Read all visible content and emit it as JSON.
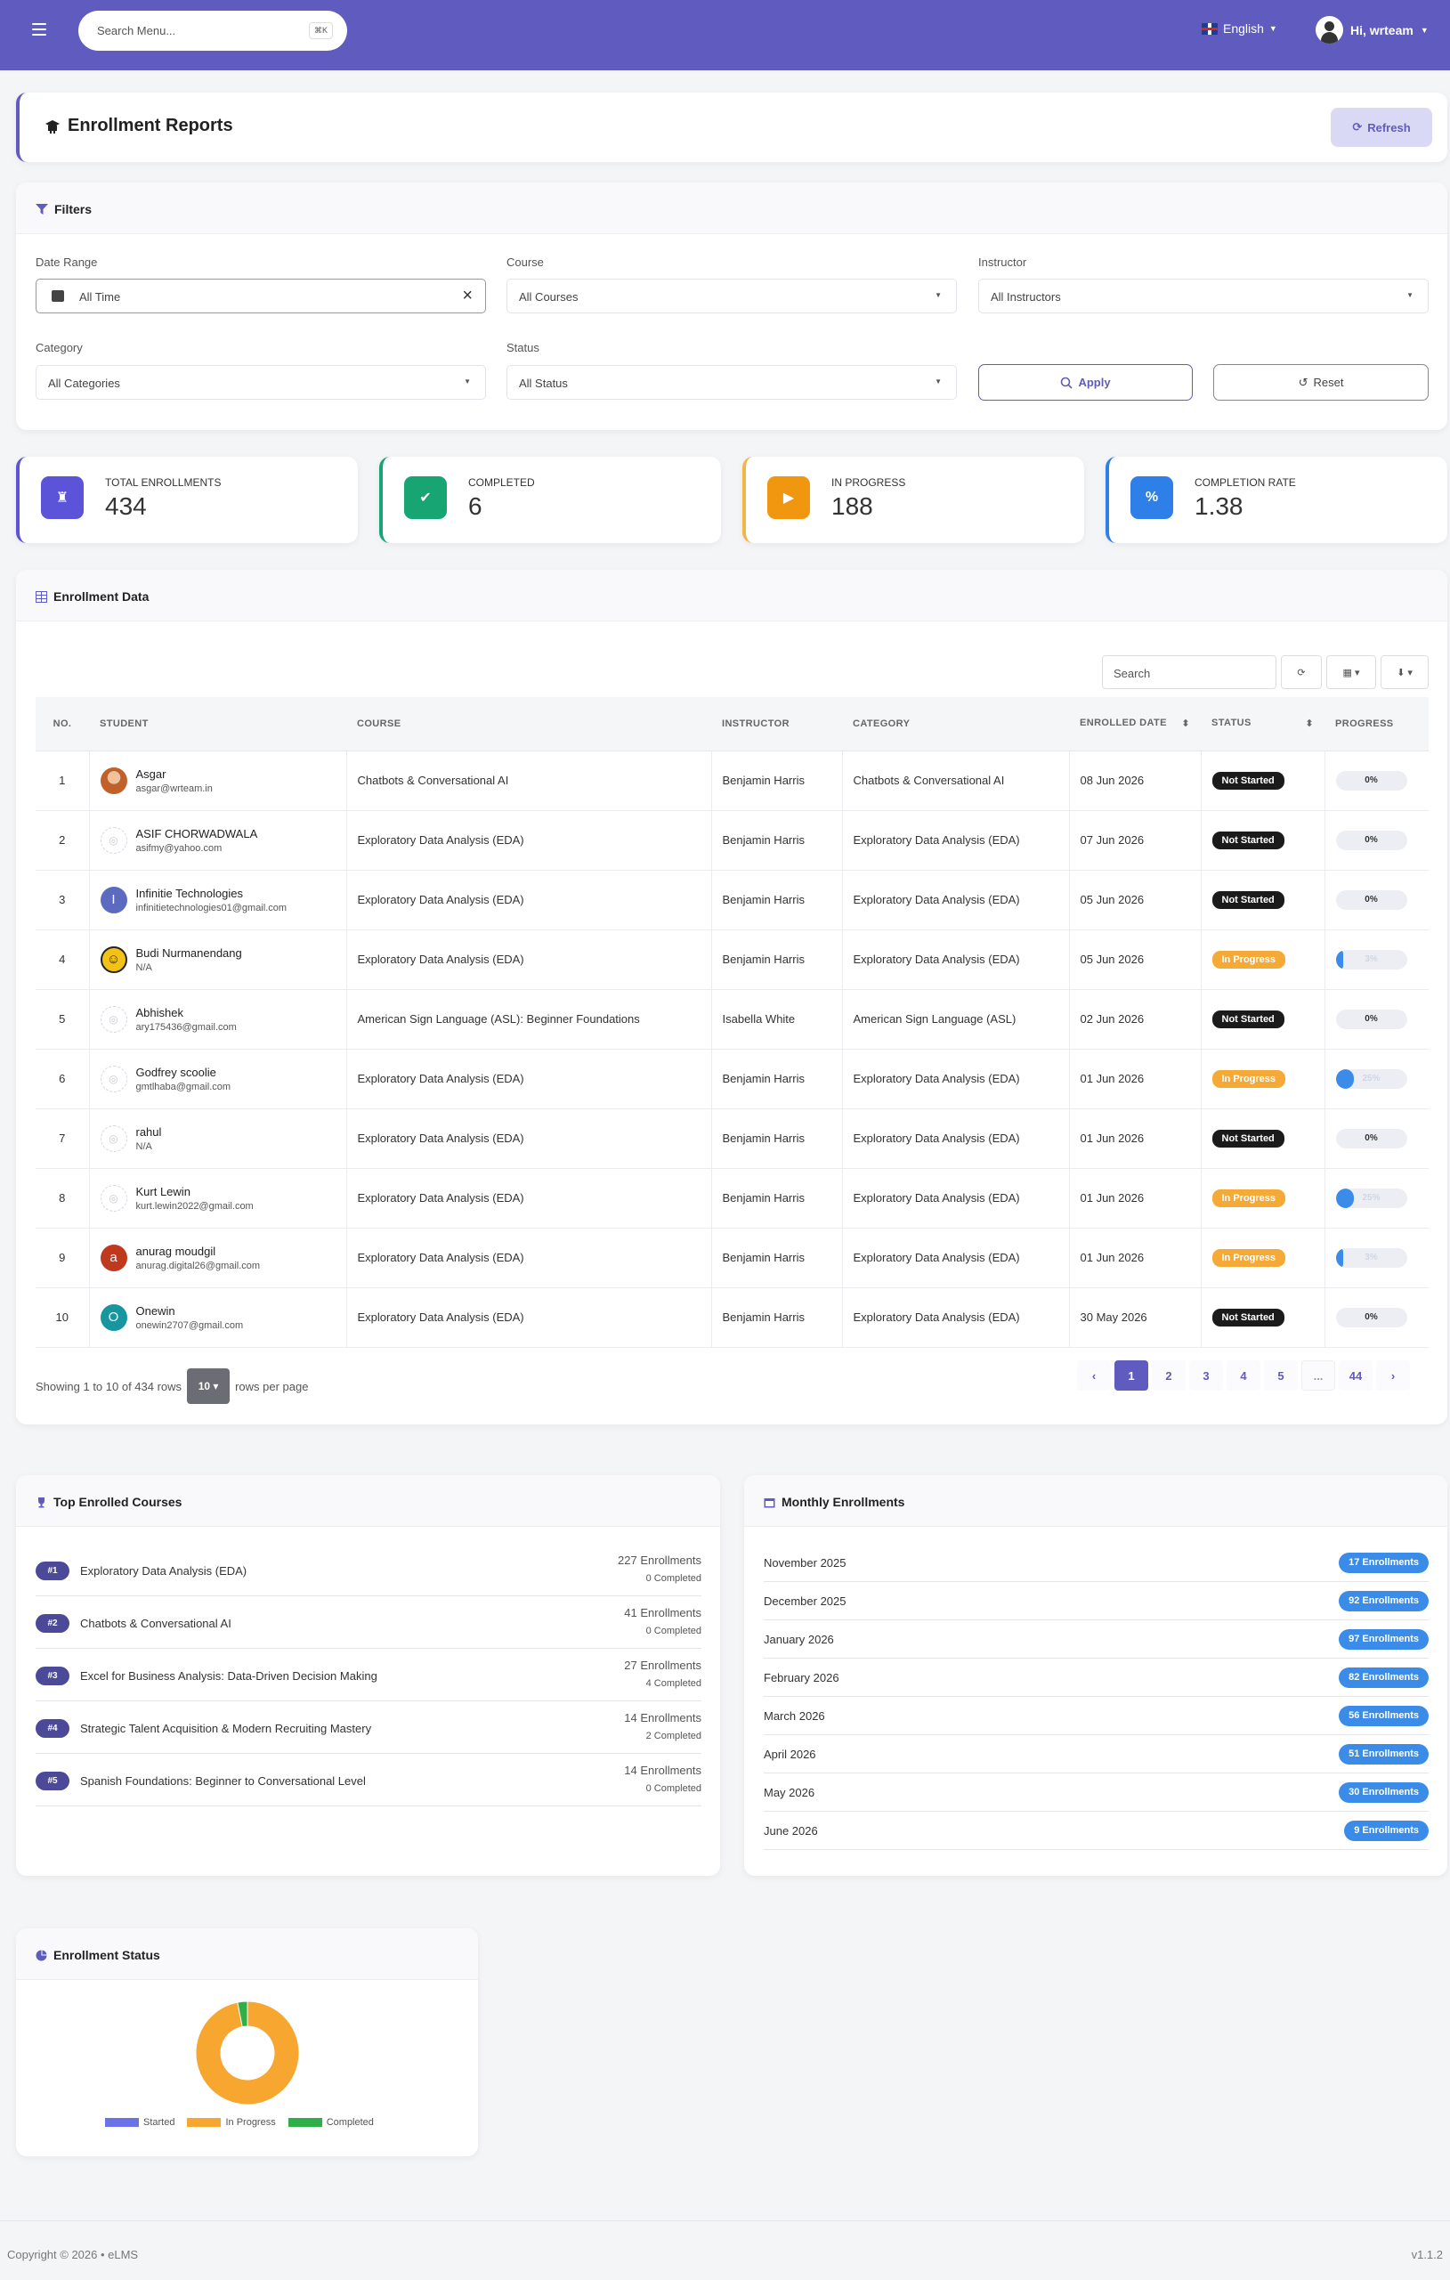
{
  "topbar": {
    "search_placeholder": "Search Menu...",
    "search_shortcut": "⌘K",
    "language": "English",
    "greeting": "Hi, wrteam"
  },
  "page": {
    "title": "Enrollment Reports",
    "refresh_label": "Refresh"
  },
  "filters": {
    "title": "Filters",
    "date_range_label": "Date Range",
    "date_range_value": "All Time",
    "course_label": "Course",
    "course_value": "All Courses",
    "instructor_label": "Instructor",
    "instructor_value": "All Instructors",
    "category_label": "Category",
    "category_value": "All Categories",
    "status_label": "Status",
    "status_value": "All Status",
    "apply_label": "Apply",
    "reset_label": "Reset"
  },
  "stats": [
    {
      "label": "TOTAL ENROLLMENTS",
      "value": "434",
      "color": "#5b54d9",
      "border": "#5b54d9",
      "glyph": "♜"
    },
    {
      "label": "COMPLETED",
      "value": "6",
      "color": "#17a673",
      "border": "#17a673",
      "glyph": "✔"
    },
    {
      "label": "IN PROGRESS",
      "value": "188",
      "color": "#f0960f",
      "border": "#f0b64a",
      "glyph": "▶"
    },
    {
      "label": "COMPLETION RATE",
      "value": "1.38",
      "color": "#2f7fe8",
      "border": "#2f7fe8",
      "glyph": "%"
    }
  ],
  "enrollment_data": {
    "title": "Enrollment Data",
    "search_placeholder": "Search",
    "columns": [
      "NO.",
      "STUDENT",
      "COURSE",
      "INSTRUCTOR",
      "CATEGORY",
      "ENROLLED DATE",
      "STATUS",
      "PROGRESS"
    ],
    "rows": [
      {
        "no": "1",
        "name": "Asgar",
        "email": "asgar@wrteam.in",
        "avatar": "photo",
        "avatar_color": "#c0602a",
        "initial": "",
        "course": "Chatbots & Conversational AI",
        "instructor": "Benjamin Harris",
        "category": "Chatbots & Conversational AI",
        "date": "08 Jun 2026",
        "status": "Not Started",
        "progress": 0,
        "progress_text": "0%"
      },
      {
        "no": "2",
        "name": "ASIF CHORWADWALA",
        "email": "asifmy@yahoo.com",
        "avatar": "placeholder",
        "avatar_color": "#ffffff",
        "initial": "",
        "course": "Exploratory Data Analysis (EDA)",
        "instructor": "Benjamin Harris",
        "category": "Exploratory Data Analysis (EDA)",
        "date": "07 Jun 2026",
        "status": "Not Started",
        "progress": 0,
        "progress_text": "0%"
      },
      {
        "no": "3",
        "name": "Infinitie Technologies",
        "email": "infinitietechnologies01@gmail.com",
        "avatar": "initial",
        "avatar_color": "#5c6bc0",
        "initial": "I",
        "course": "Exploratory Data Analysis (EDA)",
        "instructor": "Benjamin Harris",
        "category": "Exploratory Data Analysis (EDA)",
        "date": "05 Jun 2026",
        "status": "Not Started",
        "progress": 0,
        "progress_text": "0%"
      },
      {
        "no": "4",
        "name": "Budi Nurmanendang",
        "email": "N/A",
        "avatar": "smiley",
        "avatar_color": "#f2c316",
        "initial": "",
        "course": "Exploratory Data Analysis (EDA)",
        "instructor": "Benjamin Harris",
        "category": "Exploratory Data Analysis (EDA)",
        "date": "05 Jun 2026",
        "status": "In Progress",
        "progress": 3,
        "progress_text": "3%"
      },
      {
        "no": "5",
        "name": "Abhishek",
        "email": "ary175436@gmail.com",
        "avatar": "placeholder",
        "avatar_color": "#ffffff",
        "initial": "",
        "course": "American Sign Language (ASL): Beginner Foundations",
        "instructor": "Isabella White",
        "category": "American Sign Language (ASL)",
        "date": "02 Jun 2026",
        "status": "Not Started",
        "progress": 0,
        "progress_text": "0%"
      },
      {
        "no": "6",
        "name": "Godfrey scoolie",
        "email": "gmtlhaba@gmail.com",
        "avatar": "placeholder",
        "avatar_color": "#ffffff",
        "initial": "",
        "course": "Exploratory Data Analysis (EDA)",
        "instructor": "Benjamin Harris",
        "category": "Exploratory Data Analysis (EDA)",
        "date": "01 Jun 2026",
        "status": "In Progress",
        "progress": 25,
        "progress_text": "25%"
      },
      {
        "no": "7",
        "name": "rahul",
        "email": "N/A",
        "avatar": "placeholder",
        "avatar_color": "#ffffff",
        "initial": "",
        "course": "Exploratory Data Analysis (EDA)",
        "instructor": "Benjamin Harris",
        "category": "Exploratory Data Analysis (EDA)",
        "date": "01 Jun 2026",
        "status": "Not Started",
        "progress": 0,
        "progress_text": "0%"
      },
      {
        "no": "8",
        "name": "Kurt Lewin",
        "email": "kurt.lewin2022@gmail.com",
        "avatar": "placeholder",
        "avatar_color": "#ffffff",
        "initial": "",
        "course": "Exploratory Data Analysis (EDA)",
        "instructor": "Benjamin Harris",
        "category": "Exploratory Data Analysis (EDA)",
        "date": "01 Jun 2026",
        "status": "In Progress",
        "progress": 25,
        "progress_text": "25%"
      },
      {
        "no": "9",
        "name": "anurag moudgil",
        "email": "anurag.digital26@gmail.com",
        "avatar": "initial",
        "avatar_color": "#c0391f",
        "initial": "a",
        "course": "Exploratory Data Analysis (EDA)",
        "instructor": "Benjamin Harris",
        "category": "Exploratory Data Analysis (EDA)",
        "date": "01 Jun 2026",
        "status": "In Progress",
        "progress": 3,
        "progress_text": "3%"
      },
      {
        "no": "10",
        "name": "Onewin",
        "email": "onewin2707@gmail.com",
        "avatar": "initial",
        "avatar_color": "#1796a0",
        "initial": "O",
        "course": "Exploratory Data Analysis (EDA)",
        "instructor": "Benjamin Harris",
        "category": "Exploratory Data Analysis (EDA)",
        "date": "30 May 2026",
        "status": "Not Started",
        "progress": 0,
        "progress_text": "0%"
      }
    ],
    "showing_text": "Showing 1 to 10 of 434 rows",
    "rows_per_page": "10",
    "rows_per_page_suffix": "rows per page",
    "pages": [
      "‹",
      "1",
      "2",
      "3",
      "4",
      "5",
      "...",
      "44",
      "›"
    ],
    "active_page": "1"
  },
  "top_courses": {
    "title": "Top Enrolled Courses",
    "items": [
      {
        "rank": "#1",
        "name": "Exploratory Data Analysis (EDA)",
        "enrollments": "227 Enrollments",
        "completed": "0 Completed"
      },
      {
        "rank": "#2",
        "name": "Chatbots & Conversational AI",
        "enrollments": "41 Enrollments",
        "completed": "0 Completed"
      },
      {
        "rank": "#3",
        "name": "Excel for Business Analysis: Data-Driven Decision Making",
        "enrollments": "27 Enrollments",
        "completed": "4 Completed"
      },
      {
        "rank": "#4",
        "name": "Strategic Talent Acquisition & Modern Recruiting Mastery",
        "enrollments": "14 Enrollments",
        "completed": "2 Completed"
      },
      {
        "rank": "#5",
        "name": "Spanish Foundations: Beginner to Conversational Level",
        "enrollments": "14 Enrollments",
        "completed": "0 Completed"
      }
    ]
  },
  "monthly": {
    "title": "Monthly Enrollments",
    "items": [
      {
        "month": "November 2025",
        "count": "17 Enrollments"
      },
      {
        "month": "December 2025",
        "count": "92 Enrollments"
      },
      {
        "month": "January 2026",
        "count": "97 Enrollments"
      },
      {
        "month": "February 2026",
        "count": "82 Enrollments"
      },
      {
        "month": "March 2026",
        "count": "56 Enrollments"
      },
      {
        "month": "April 2026",
        "count": "51 Enrollments"
      },
      {
        "month": "May 2026",
        "count": "30 Enrollments"
      },
      {
        "month": "June 2026",
        "count": "9 Enrollments"
      }
    ]
  },
  "enrollment_status": {
    "title": "Enrollment Status"
  },
  "chart_data": {
    "type": "pie",
    "title": "Enrollment Status",
    "categories": [
      "Started",
      "In Progress",
      "Completed"
    ],
    "values": [
      0,
      188,
      6
    ],
    "colors": [
      "#6b72e8",
      "#f7a630",
      "#2fae49"
    ],
    "legend_position": "bottom"
  },
  "footer": {
    "copyright": "Copyright © 2026 • eLMS",
    "version": "v1.1.2"
  }
}
